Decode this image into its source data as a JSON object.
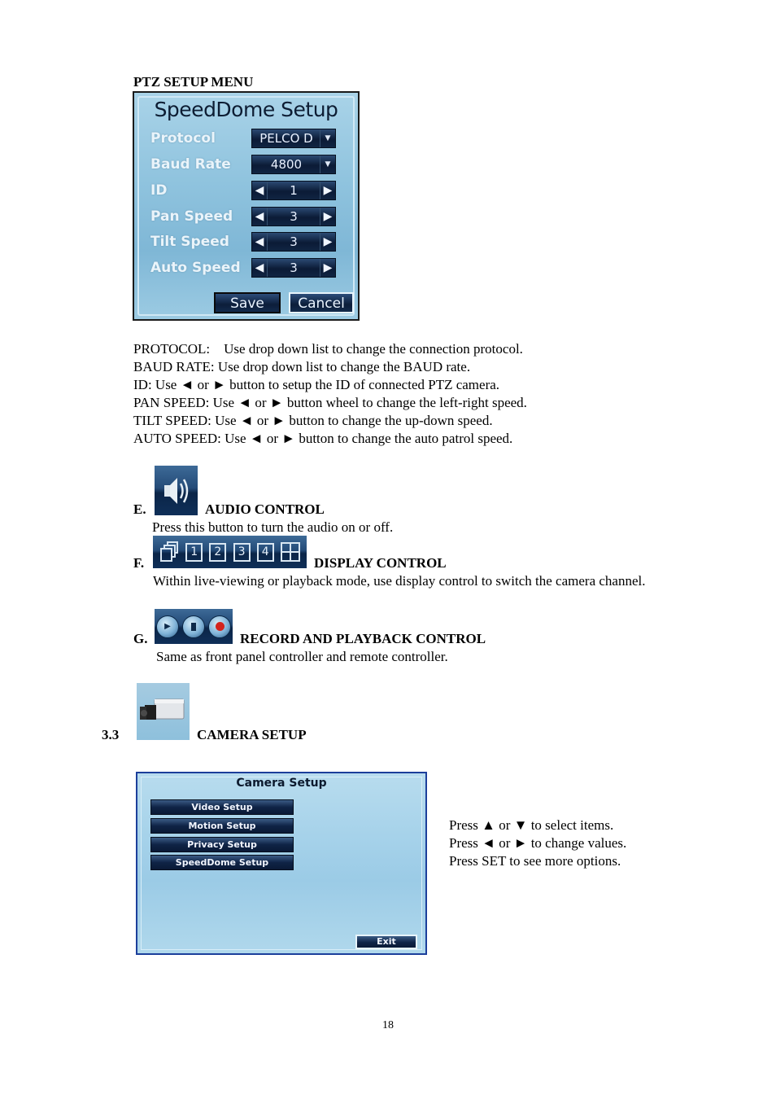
{
  "ptz_section": {
    "heading": "PTZ SETUP MENU",
    "panel": {
      "title": "SpeedDome Setup",
      "rows": [
        {
          "label": "Protocol",
          "value": "PELCO D",
          "control": "dropdown"
        },
        {
          "label": "Baud Rate",
          "value": "4800",
          "control": "dropdown"
        },
        {
          "label": "ID",
          "value": "1",
          "control": "stepper"
        },
        {
          "label": "Pan Speed",
          "value": "3",
          "control": "stepper"
        },
        {
          "label": "Tilt Speed",
          "value": "3",
          "control": "stepper"
        },
        {
          "label": "Auto Speed",
          "value": "3",
          "control": "stepper"
        }
      ],
      "save_label": "Save",
      "cancel_label": "Cancel"
    },
    "descriptions": [
      "PROTOCOL:    Use drop down list to change the connection protocol.",
      "BAUD RATE: Use drop down list to change the BAUD rate.",
      "ID: Use ◄ or ► button to setup the ID of connected PTZ camera.",
      "PAN SPEED: Use ◄ or ► button wheel to change the left-right speed.",
      "TILT SPEED: Use ◄ or ► button to change the up-down speed.",
      "AUTO SPEED: Use ◄ or ► button to change the auto patrol speed."
    ]
  },
  "audio_control": {
    "letter": "E.",
    "title": "AUDIO CONTROL",
    "description": "Press this button to turn the audio on or off.",
    "icon": "speaker-icon"
  },
  "display_control": {
    "letter": "F.",
    "title": "DISPLAY CONTROL",
    "description": "Within live-viewing or playback mode, use display control to switch the camera channel.",
    "icons": [
      "sequence-icon",
      "1",
      "2",
      "3",
      "4",
      "quad-view-icon"
    ]
  },
  "record_control": {
    "letter": "G.",
    "title": "RECORD AND PLAYBACK CONTROL",
    "description": "Same as front panel controller and remote controller.",
    "icons": [
      "play-icon",
      "stop-icon",
      "record-icon"
    ]
  },
  "camera_setup": {
    "number": "3.3",
    "title": "CAMERA SETUP",
    "panel": {
      "title": "Camera Setup",
      "items": [
        "Video Setup",
        "Motion Setup",
        "Privacy Setup",
        "SpeedDome Setup"
      ],
      "exit_label": "Exit"
    },
    "instructions": [
      "Press ▲ or ▼ to select items.",
      "Press ◄ or ► to change values.",
      "Press SET to see more options."
    ]
  },
  "page_number": "18"
}
